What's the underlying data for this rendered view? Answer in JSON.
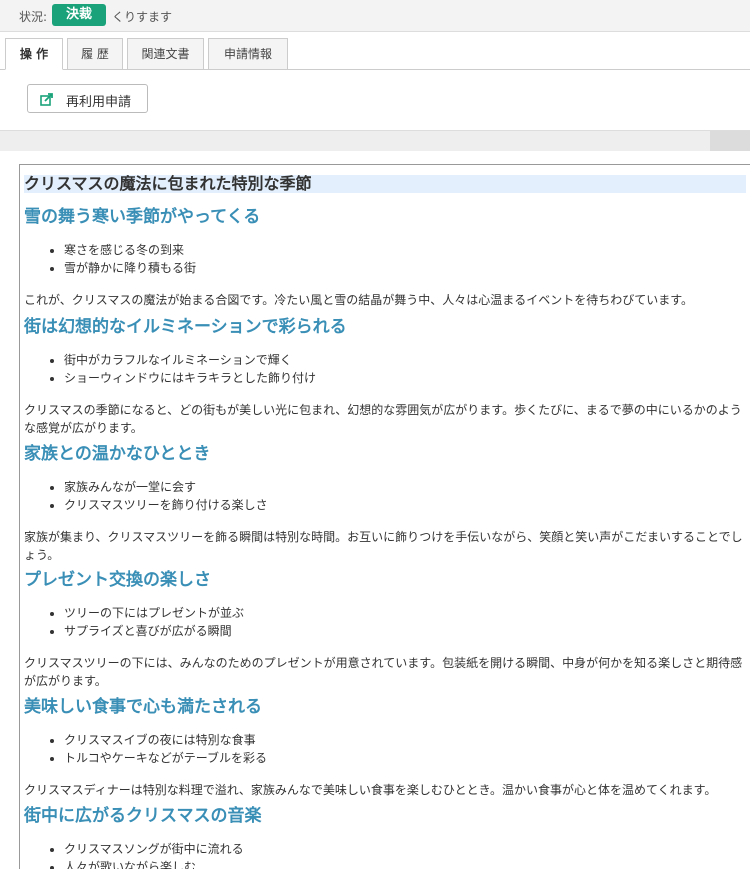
{
  "status": {
    "label": "状況:",
    "badge": "決裁",
    "text": "くりすます"
  },
  "tabs": [
    {
      "label": "操 作",
      "active": true
    },
    {
      "label": "履 歴",
      "active": false
    },
    {
      "label": "関連文書",
      "active": false
    },
    {
      "label": "申請情報",
      "active": false
    }
  ],
  "actions": {
    "reuse_label": "再利用申請",
    "reuse_icon": "share-icon"
  },
  "colors": {
    "badge": "#1aa37a",
    "heading": "#3a8fb7",
    "title_highlight": "#e3effc"
  },
  "document": {
    "title": "クリスマスの魔法に包まれた特別な季節",
    "sections": [
      {
        "heading": "雪の舞う寒い季節がやってくる",
        "bullets": [
          "寒さを感じる冬の到来",
          "雪が静かに降り積もる街"
        ],
        "paragraph": "これが、クリスマスの魔法が始まる合図です。冷たい風と雪の結晶が舞う中、人々は心温まるイベントを待ちわびています。"
      },
      {
        "heading": "街は幻想的なイルミネーションで彩られる",
        "bullets": [
          "街中がカラフルなイルミネーションで輝く",
          "ショーウィンドウにはキラキラとした飾り付け"
        ],
        "paragraph": "クリスマスの季節になると、どの街もが美しい光に包まれ、幻想的な雰囲気が広がります。歩くたびに、まるで夢の中にいるかのような感覚が広がります。"
      },
      {
        "heading": "家族との温かなひととき",
        "bullets": [
          "家族みんなが一堂に会す",
          "クリスマスツリーを飾り付ける楽しさ"
        ],
        "paragraph": "家族が集まり、クリスマスツリーを飾る瞬間は特別な時間。お互いに飾りつけを手伝いながら、笑顔と笑い声がこだまいすることでしょう。"
      },
      {
        "heading": "プレゼント交換の楽しさ",
        "bullets": [
          "ツリーの下にはプレゼントが並ぶ",
          "サプライズと喜びが広がる瞬間"
        ],
        "paragraph": "クリスマスツリーの下には、みんなのためのプレゼントが用意されています。包装紙を開ける瞬間、中身が何かを知る楽しさと期待感が広がります。"
      },
      {
        "heading": "美味しい食事で心も満たされる",
        "bullets": [
          "クリスマスイブの夜には特別な食事",
          "トルコやケーキなどがテーブルを彩る"
        ],
        "paragraph": "クリスマスディナーは特別な料理で溢れ、家族みんなで美味しい食事を楽しむひととき。温かい食事が心と体を温めてくれます。"
      },
      {
        "heading": "街中に広がるクリスマスの音楽",
        "bullets": [
          "クリスマスソングが街中に流れる",
          "人々が歌いながら楽しむ"
        ],
        "paragraph": ""
      }
    ]
  }
}
